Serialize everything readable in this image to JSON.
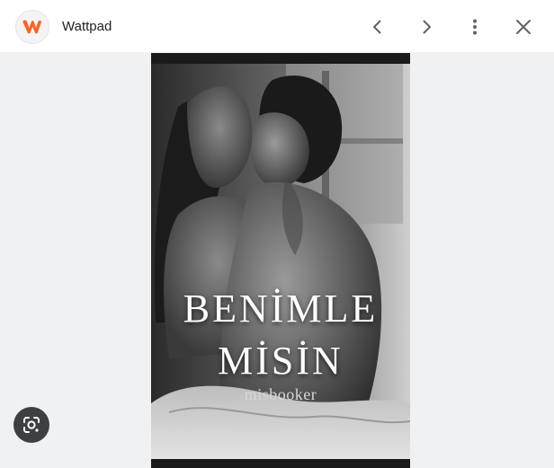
{
  "header": {
    "site_name": "Wattpad",
    "logo_icon": "wattpad-w-icon",
    "logo_color": "#ff6122",
    "actions": [
      "chevron-left-icon",
      "chevron-right-icon",
      "more-vert-icon",
      "close-icon"
    ]
  },
  "viewer": {
    "cover": {
      "title_line1": "BENİMLE",
      "title_line2": "MİSİN",
      "author": "misbooker"
    },
    "lens_icon": "google-lens-icon"
  },
  "colors": {
    "background": "#f0f1f3",
    "header_bg": "#ffffff",
    "icon": "#5f6368",
    "lens_bg": "#3c4043"
  }
}
